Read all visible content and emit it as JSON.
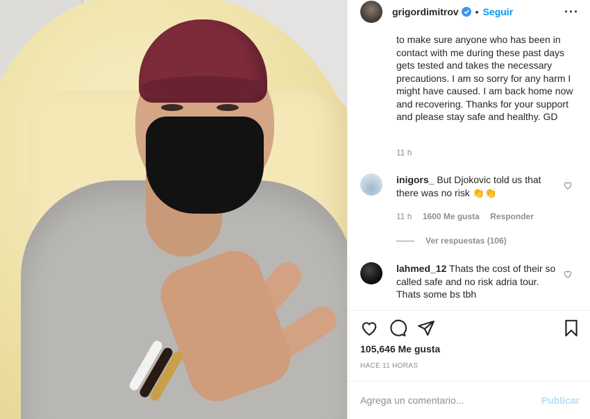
{
  "post": {
    "username": "grigordimitrov",
    "dot": "•",
    "follow_label": "Seguir",
    "more_label": "···",
    "caption": "to make sure anyone who has been in contact with me during these past days gets tested and takes the necessary precautions. I am so sorry for any harm I might have caused. I am back home now and recovering. Thanks for your support and please stay safe and healthy. GD",
    "caption_time": "11 h"
  },
  "comments": [
    {
      "user": "inigors_",
      "text": "But Djokovic told us that there was no risk 👏👏",
      "time": "11 h",
      "likes": "1600 Me gusta",
      "reply_label": "Responder",
      "view_replies": "Ver respuestas (106)"
    },
    {
      "user": "lahmed_12",
      "text": "Thats the cost of their so called safe and no risk adria tour. Thats some bs tbh"
    }
  ],
  "footer": {
    "likes_count": "105,646 Me gusta",
    "time_ago": "HACE 11 HORAS",
    "comment_placeholder": "Agrega un comentario...",
    "publish_label": "Publicar"
  },
  "colors": {
    "accent": "#0095f6",
    "publish_disabled": "#b2dffc",
    "cap": "#7d2a3a",
    "mask": "#121212"
  }
}
